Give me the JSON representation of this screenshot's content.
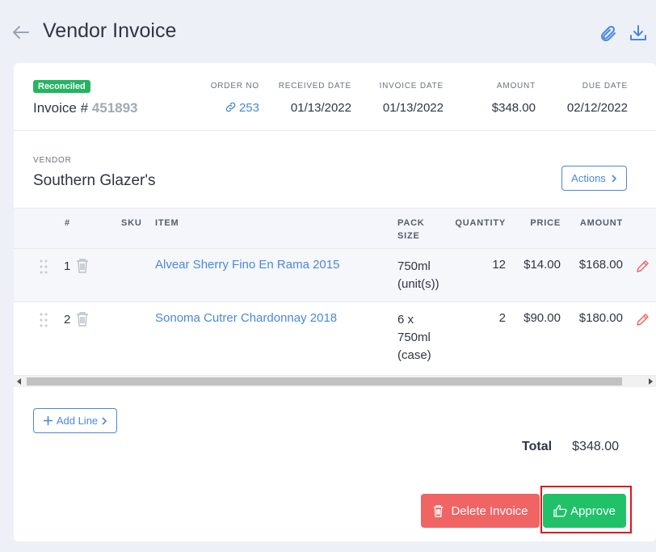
{
  "header": {
    "title": "Vendor Invoice"
  },
  "invoice": {
    "status": "Reconciled",
    "label": "Invoice #",
    "number": "451893",
    "order_no_label": "ORDER NO",
    "order_no": "253",
    "received_label": "RECEIVED DATE",
    "received": "01/13/2022",
    "invoice_date_label": "INVOICE DATE",
    "invoice_date": "01/13/2022",
    "amount_label": "AMOUNT",
    "amount": "$348.00",
    "due_label": "DUE DATE",
    "due": "02/12/2022"
  },
  "vendor": {
    "label": "VENDOR",
    "name": "Southern Glazer's",
    "actions_label": "Actions"
  },
  "table": {
    "columns": [
      "#",
      "SKU",
      "ITEM",
      "PACK",
      "SIZE",
      "QUANTITY",
      "PRICE",
      "AMOUNT"
    ],
    "rows": [
      {
        "no": "1",
        "item": "Alvear Sherry Fino En Rama 2015",
        "pack_lines": [
          "750ml",
          "(unit(s))"
        ],
        "qty": "12",
        "price": "$14.00",
        "amount": "$168.00"
      },
      {
        "no": "2",
        "item": "Sonoma Cutrer Chardonnay 2018",
        "pack_lines": [
          "6 x",
          "750ml",
          "(case)"
        ],
        "qty": "2",
        "price": "$90.00",
        "amount": "$180.00"
      }
    ]
  },
  "add_line_label": "Add Line",
  "totals": {
    "label": "Total",
    "value": "$348.00"
  },
  "buttons": {
    "delete": "Delete Invoice",
    "approve": "Approve"
  },
  "colors": {
    "accent": "#4a88d6",
    "reconciled": "#24b563",
    "delete": "#f06464",
    "approve": "#21c16a",
    "highlight": "#e3141a"
  }
}
